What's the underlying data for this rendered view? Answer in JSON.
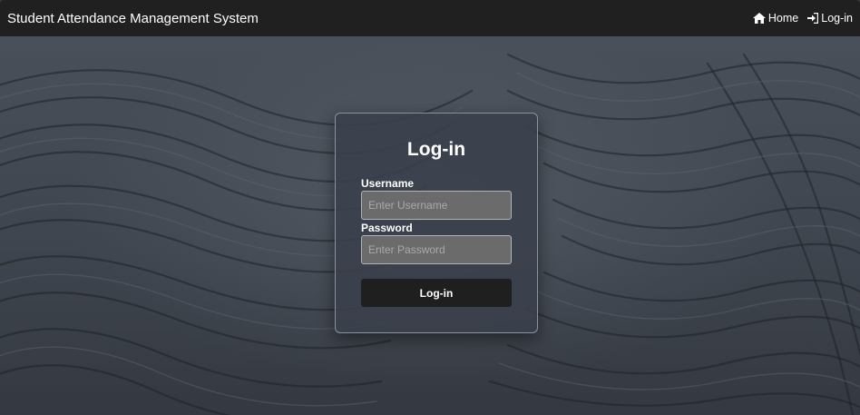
{
  "navbar": {
    "brand": "Student Attendance Management System",
    "links": [
      {
        "label": "Home",
        "icon": "home-icon"
      },
      {
        "label": "Log-in",
        "icon": "sign-in-icon"
      }
    ]
  },
  "login": {
    "title": "Log-in",
    "username_label": "Username",
    "username_placeholder": "Enter Username",
    "username_value": "",
    "password_label": "Password",
    "password_placeholder": "Enter Password",
    "password_value": "",
    "submit_label": "Log-in"
  },
  "colors": {
    "navbar_bg": "#202020",
    "card_bg": "#3a404b",
    "input_bg": "#6b6b6b",
    "button_bg": "#1f1f1f",
    "text": "#ffffff"
  }
}
